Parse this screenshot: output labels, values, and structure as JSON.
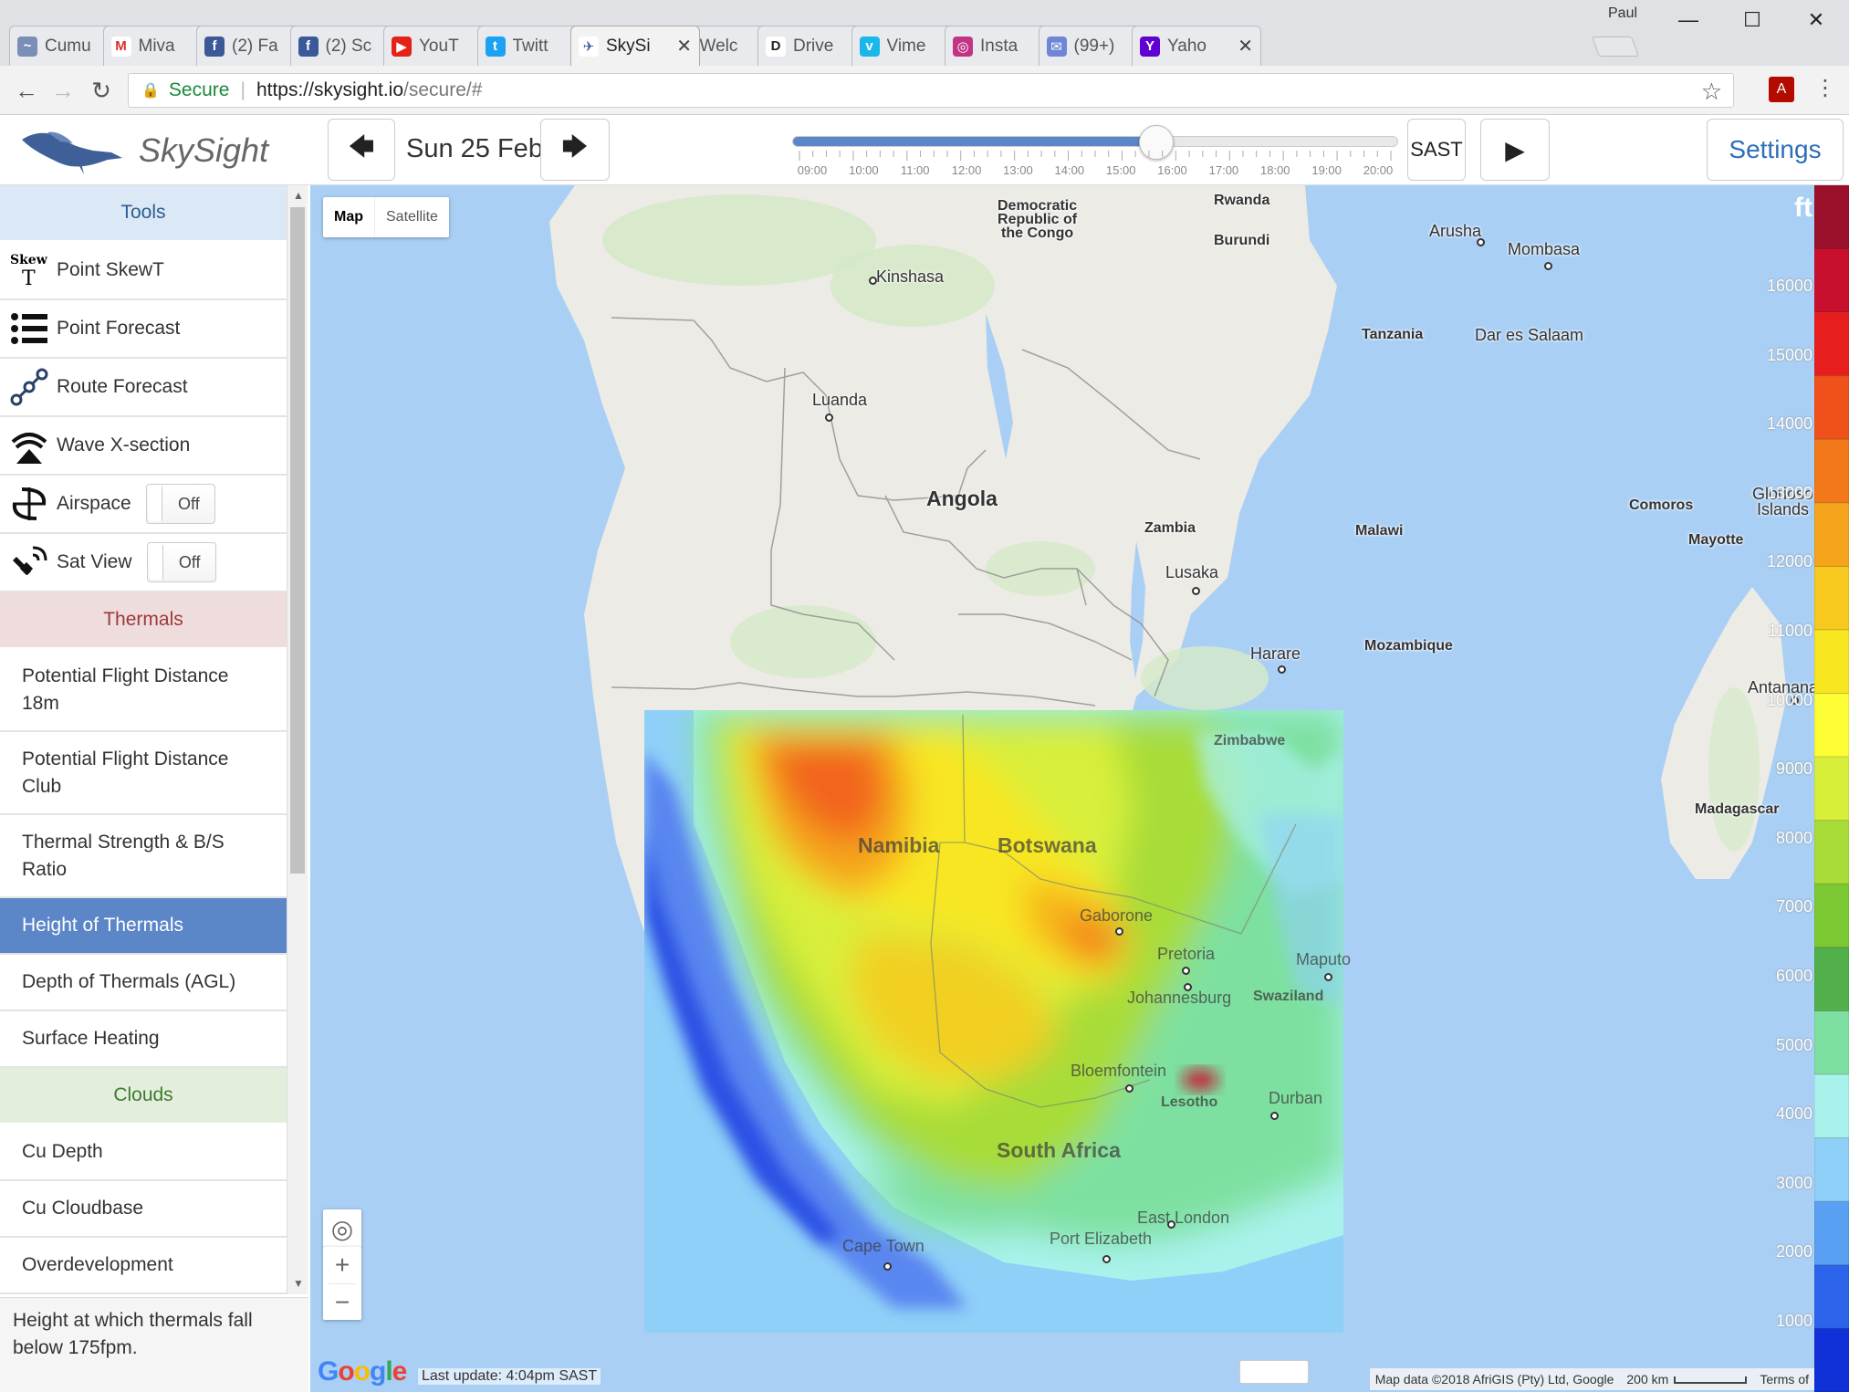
{
  "browser": {
    "profile_name": "Paul",
    "tabs": [
      {
        "title": "Cumu",
        "fav_color": "#7a8fb5",
        "fav_glyph": "~"
      },
      {
        "title": "Miva",
        "fav_color": "#ffffff",
        "fav_glyph": "M",
        "fav_text_color": "#d93025"
      },
      {
        "title": "(2) Fa",
        "fav_color": "#3b5998",
        "fav_glyph": "f"
      },
      {
        "title": "(2) Sc",
        "fav_color": "#3b5998",
        "fav_glyph": "f"
      },
      {
        "title": "YouT",
        "fav_color": "#e62117",
        "fav_glyph": "▶"
      },
      {
        "title": "Twitt",
        "fav_color": "#1da1f2",
        "fav_glyph": "t"
      },
      {
        "title": "SkySi",
        "fav_color": "#ffffff",
        "fav_glyph": "✈",
        "fav_text_color": "#3d5f9a"
      },
      {
        "title": "Welc",
        "fav_color": "#ffffff",
        "fav_glyph": "✱",
        "fav_text_color": "#4285f4"
      },
      {
        "title": "Drive",
        "fav_color": "#ffffff",
        "fav_glyph": "D",
        "fav_text_color": "#222"
      },
      {
        "title": "Vime",
        "fav_color": "#1ab7ea",
        "fav_glyph": "v"
      },
      {
        "title": "Insta",
        "fav_color": "#c13584",
        "fav_glyph": "◎"
      },
      {
        "title": "(99+)",
        "fav_color": "#6f86d6",
        "fav_glyph": "✉"
      },
      {
        "title": "Yaho",
        "fav_color": "#5f01d1",
        "fav_glyph": "Y"
      }
    ],
    "active_tab": 6,
    "close_glyph": "✕",
    "window_controls": {
      "minimize": "—",
      "maximize": "☐",
      "close": "✕"
    },
    "nav": {
      "back": "←",
      "forward": "→",
      "reload": "↻"
    },
    "secure_label": "Secure",
    "url_host": "https://skysight.io",
    "url_path": "/secure/#",
    "star_icon": "☆",
    "menu_icon": "⋮",
    "pdf_glyph": "A"
  },
  "app": {
    "brand": "SkySight",
    "date": "Sun 25 Feb",
    "prev_arrow": "🡄",
    "next_arrow": "🡆",
    "timezone": "SAST",
    "play_icon": "▶",
    "settings_label": "Settings",
    "time_slider": {
      "labels": [
        "09:00",
        "10:00",
        "11:00",
        "12:00",
        "13:00",
        "14:00",
        "15:00",
        "16:00",
        "17:00",
        "18:00",
        "19:00",
        "20:00"
      ],
      "value": 0.6
    }
  },
  "sidebar": {
    "tools_header": "Tools",
    "tools": [
      {
        "label": "Point SkewT",
        "icon": "skewt-icon"
      },
      {
        "label": "Point Forecast",
        "icon": "list-icon"
      },
      {
        "label": "Route Forecast",
        "icon": "route-icon"
      },
      {
        "label": "Wave X-section",
        "icon": "wave-icon"
      },
      {
        "label": "Airspace",
        "icon": "airspace-icon",
        "toggle": "Off"
      },
      {
        "label": "Sat View",
        "icon": "satellite-icon",
        "toggle": "Off"
      }
    ],
    "thermals_header": "Thermals",
    "thermals": [
      {
        "label": "Potential Flight Distance 18m"
      },
      {
        "label": "Potential Flight Distance Club"
      },
      {
        "label": "Thermal Strength & B/S Ratio"
      },
      {
        "label": "Height of Thermals",
        "active": true
      },
      {
        "label": "Depth of Thermals (AGL)"
      },
      {
        "label": "Surface Heating"
      }
    ],
    "clouds_header": "Clouds",
    "clouds": [
      {
        "label": "Cu Depth"
      },
      {
        "label": "Cu Cloudbase"
      },
      {
        "label": "Overdevelopment"
      }
    ],
    "description": "Height at which thermals fall below 175fpm."
  },
  "map": {
    "map_type": {
      "map": "Map",
      "satellite": "Satellite",
      "selected": "Map"
    },
    "zoom_in": "+",
    "zoom_out": "−",
    "locate_icon": "◎",
    "google_logo": "Google",
    "last_update": "Last update: 4:04pm SAST",
    "attribution": "Map data ©2018 AfriGIS (Pty) Ltd, Google",
    "scale_label": "200 km",
    "terms": "Terms of",
    "labels": {
      "drc": "Democratic\nRepublic of\nthe Congo",
      "rwanda": "Rwanda",
      "burundi": "Burundi",
      "arusha": "Arusha",
      "mombasa": "Mombasa",
      "kinshasa": "Kinshasa",
      "tanzania": "Tanzania",
      "dar": "Dar es Salaam",
      "luanda": "Luanda",
      "angola": "Angola",
      "comoros": "Comoros",
      "glorioso": "Glorioso\nIslands",
      "mayotte": "Mayotte",
      "zambia": "Zambia",
      "malawi": "Malawi",
      "lusaka": "Lusaka",
      "harare": "Harare",
      "mozambique": "Mozambique",
      "antananarivo": "Antananar",
      "zimbabwe": "Zimbabwe",
      "madagascar": "Madagascar",
      "namibia": "Namibia",
      "botswana": "Botswana",
      "gaborone": "Gaborone",
      "pretoria": "Pretoria",
      "maputo": "Maputo",
      "johannesburg": "Johannesburg",
      "swaziland": "Swaziland",
      "bloemfontein": "Bloemfontein",
      "lesotho": "Lesotho",
      "durban": "Durban",
      "south_africa": "South Africa",
      "east_london": "East London",
      "cape_town": "Cape Town",
      "port_elizabeth": "Port Elizabeth"
    }
  },
  "legend": {
    "unit": "ft",
    "ticks": [
      "16000",
      "15000",
      "14000",
      "13000",
      "12000",
      "11000",
      "10000",
      "9000",
      "8000",
      "7000",
      "6000",
      "5000",
      "4000",
      "3000",
      "2000",
      "1000"
    ],
    "colors": [
      "#9a0f2a",
      "#c8102e",
      "#e81e1e",
      "#f0501a",
      "#f2781a",
      "#f5a41c",
      "#f7c81e",
      "#f8e620",
      "#fdfd33",
      "#d8ef3a",
      "#a8dc38",
      "#7cc832",
      "#52b04a",
      "#7ee0a0",
      "#a9f2ec",
      "#8fd0f8",
      "#5aa0f2",
      "#2c64ec",
      "#1030d8"
    ]
  }
}
